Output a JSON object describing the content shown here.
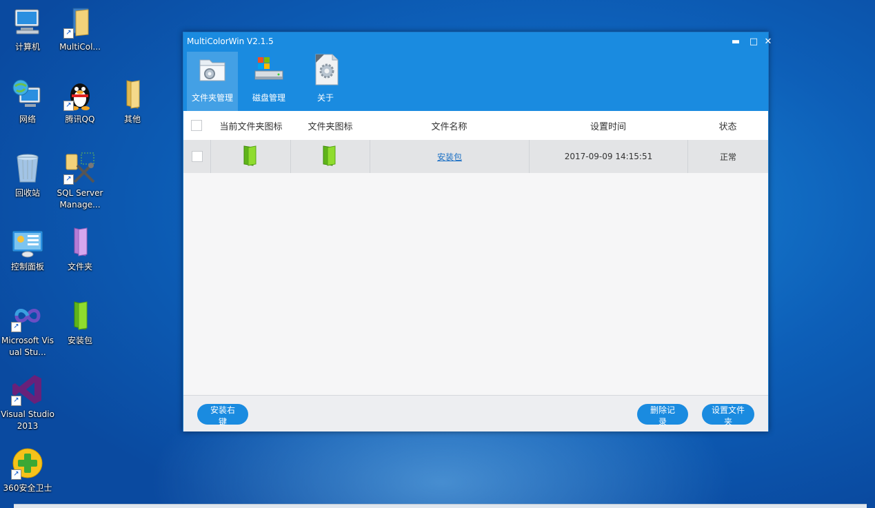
{
  "desktop": {
    "icons": [
      {
        "label": "计算机"
      },
      {
        "label": "MultiCol..."
      },
      {
        "label": "网络"
      },
      {
        "label": "腾讯QQ"
      },
      {
        "label": "其他"
      },
      {
        "label": "回收站"
      },
      {
        "label": "SQL Server Manage..."
      },
      {
        "label": "控制面板"
      },
      {
        "label": "文件夹"
      },
      {
        "label": "Microsoft Visual Stu..."
      },
      {
        "label": "安装包"
      },
      {
        "label": "Visual Studio 2013"
      },
      {
        "label": "360安全卫士"
      }
    ]
  },
  "window": {
    "title": "MultiColorWin V2.1.5",
    "controls": {
      "minimize": "▬",
      "maximize": "□",
      "close": "✕"
    },
    "tabs": [
      {
        "label": "文件夹管理",
        "active": true
      },
      {
        "label": "磁盘管理",
        "active": false
      },
      {
        "label": "关于",
        "active": false
      }
    ],
    "table": {
      "columns": [
        "当前文件夹图标",
        "文件夹图标",
        "文件名称",
        "设置时间",
        "状态"
      ],
      "rows": [
        {
          "name": "安装包",
          "time": "2017-09-09 14:15:51",
          "status": "正常"
        }
      ]
    },
    "footer": {
      "install_context_menu": "安装右键",
      "delete_records": "删除记录",
      "set_folder": "设置文件夹"
    }
  },
  "colors": {
    "accent": "#1a8be0",
    "folder_green": "#7ed321",
    "folder_purple": "#c58be0"
  }
}
